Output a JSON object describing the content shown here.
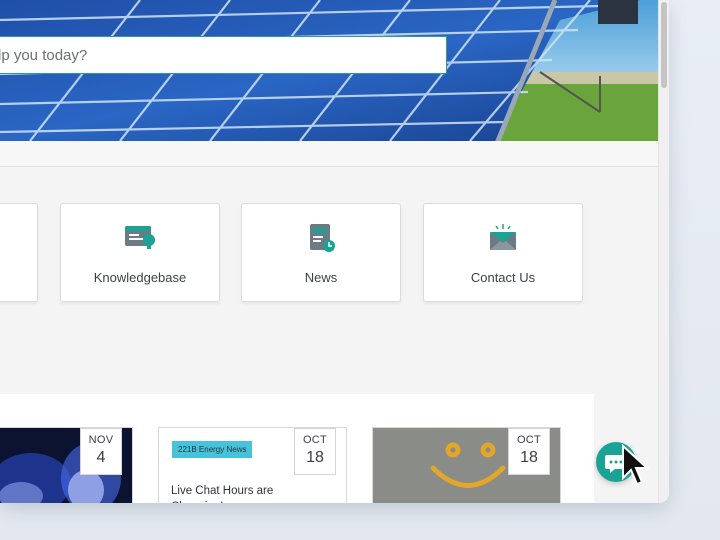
{
  "search": {
    "placeholder": "lp you today?"
  },
  "tiles": [
    {
      "label": "Knowledgebase",
      "icon": "knowledgebase-icon"
    },
    {
      "label": "News",
      "icon": "news-icon"
    },
    {
      "label": "Contact Us",
      "icon": "contact-envelope-icon"
    }
  ],
  "news": [
    {
      "month": "NOV",
      "day": "4"
    },
    {
      "month": "OCT",
      "day": "18",
      "tag": "221B Energy News",
      "title": "Live Chat Hours are Changing!"
    },
    {
      "month": "OCT",
      "day": "18"
    }
  ],
  "colors": {
    "accent": "#1aa394",
    "tag": "#48c2d8",
    "border": "#2e9c8e"
  }
}
